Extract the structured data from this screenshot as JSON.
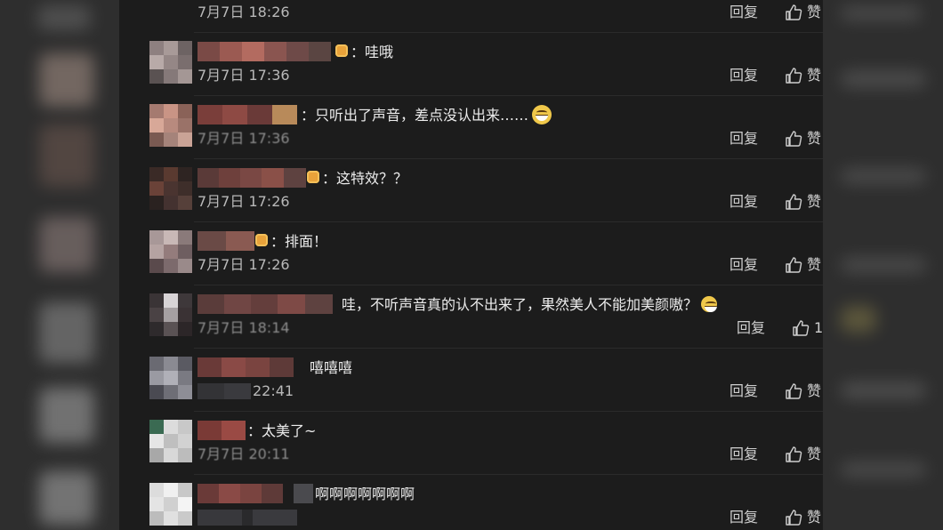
{
  "comments": [
    {
      "text": "",
      "time": "7月7日 18:26",
      "reply_label": "回复",
      "like_label": "赞"
    },
    {
      "text": "：哇哦",
      "time": "7月7日 17:36",
      "reply_label": "回复",
      "like_label": "赞"
    },
    {
      "text": "：只听出了声音，差点没认出来……",
      "time": "7月7日 17:36",
      "reply_label": "回复",
      "like_label": "赞"
    },
    {
      "text": "：这特效？？",
      "time": "7月7日 17:26",
      "reply_label": "回复",
      "like_label": "赞"
    },
    {
      "text": "：排面！",
      "time": "7月7日 17:26",
      "reply_label": "回复",
      "like_label": "赞"
    },
    {
      "text": "哇，不听声音真的认不出来了，果然美人不能加美颜嗷？",
      "time": "7月7日 18:14",
      "reply_label": "回复",
      "like_label": "1"
    },
    {
      "text": "嘻嘻嘻",
      "time": "22:41",
      "reply_label": "回复",
      "like_label": "赞"
    },
    {
      "text": "：太美了~",
      "time": "7月7日 20:11",
      "reply_label": "回复",
      "like_label": "赞"
    },
    {
      "text": "啊啊啊啊啊啊啊",
      "time": "",
      "reply_label": "回复",
      "like_label": "赞"
    }
  ],
  "icons": {
    "like": "thumbs-up-icon",
    "emoji": "grinning-face-icon",
    "badge": "sticker-emoji-icon"
  },
  "colors": {
    "panel_background": "#1c1c1c",
    "text_primary": "#ececec",
    "text_secondary": "#b9b9b9",
    "emoji_yellow": "#f0c84a"
  }
}
